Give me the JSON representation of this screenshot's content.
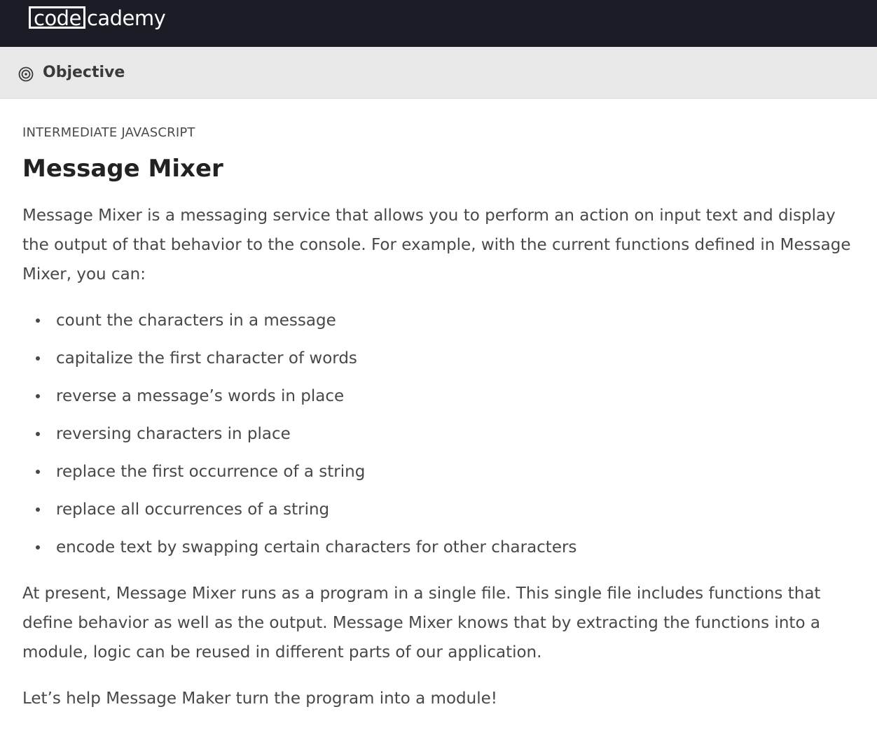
{
  "header": {
    "logo_boxed": "code",
    "logo_rest": "cademy"
  },
  "objective_bar": {
    "icon": "target-icon",
    "label": "Objective"
  },
  "lesson": {
    "course": "INTERMEDIATE JAVASCRIPT",
    "title": "Message Mixer",
    "intro": "Message Mixer is a messaging service that allows you to perform an action on input text and display the output of that behavior to the console. For example, with the current functions defined in Message Mixer, you can:",
    "bullets": [
      "count the characters in a message",
      "capitalize the first character of words",
      "reverse a message’s words in place",
      "reversing characters in place",
      "replace the first occurrence of a string",
      "replace all occurrences of a string",
      "encode text by swapping certain characters for other characters"
    ],
    "paragraph2": "At present, Message Mixer runs as a program in a single file. This single file includes functions that define behavior as well as the output. Message Mixer knows that by extracting the functions into a module, logic can be reused in different parts of our application.",
    "paragraph3": "Let’s help Message Maker turn the program into a module!"
  },
  "colors": {
    "topbar": "#1b1c25",
    "objective_bar": "#e9e9e9",
    "body_text": "#484848",
    "title_text": "#222222"
  }
}
